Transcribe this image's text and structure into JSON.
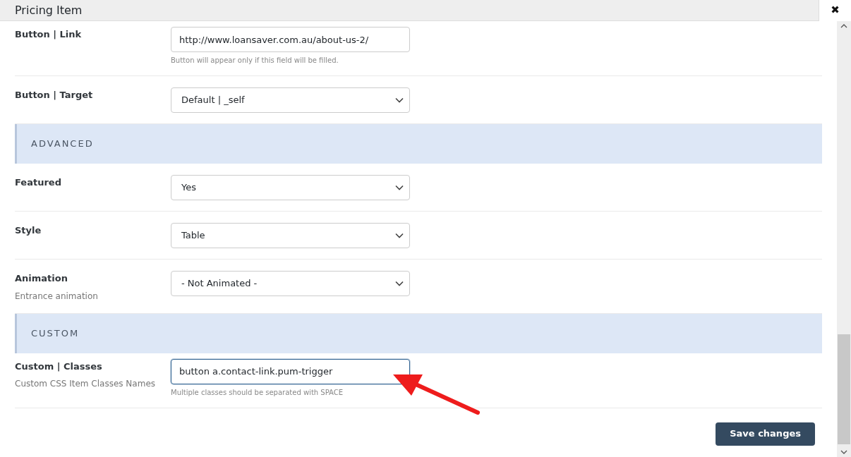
{
  "dialog": {
    "title": "Pricing Item",
    "close_icon_label": "✖"
  },
  "items": [
    {
      "kind": "field",
      "label": "Button | Link",
      "control": {
        "kind": "text",
        "value": "http://www.loansaver.com.au/about-us-2/",
        "focused": false
      },
      "hint": "Button will appear only if this field will be filled."
    },
    {
      "kind": "field",
      "label": "Button | Target",
      "control": {
        "kind": "select",
        "value": "Default | _self"
      }
    },
    {
      "kind": "section",
      "label": "ADVANCED"
    },
    {
      "kind": "field",
      "label": "Featured",
      "control": {
        "kind": "select",
        "value": "Yes"
      }
    },
    {
      "kind": "field",
      "label": "Style",
      "control": {
        "kind": "select",
        "value": "Table"
      }
    },
    {
      "kind": "field",
      "label": "Animation",
      "description": "Entrance animation",
      "control": {
        "kind": "select",
        "value": "- Not Animated -"
      }
    },
    {
      "kind": "section",
      "label": "CUSTOM"
    },
    {
      "kind": "field",
      "label": "Custom | Classes",
      "description": "Custom CSS Item Classes Names",
      "control": {
        "kind": "text",
        "value": "button a.contact-link.pum-trigger",
        "focused": true
      },
      "hint": "Multiple classes should be separated with SPACE"
    }
  ],
  "save_button": "Save changes"
}
